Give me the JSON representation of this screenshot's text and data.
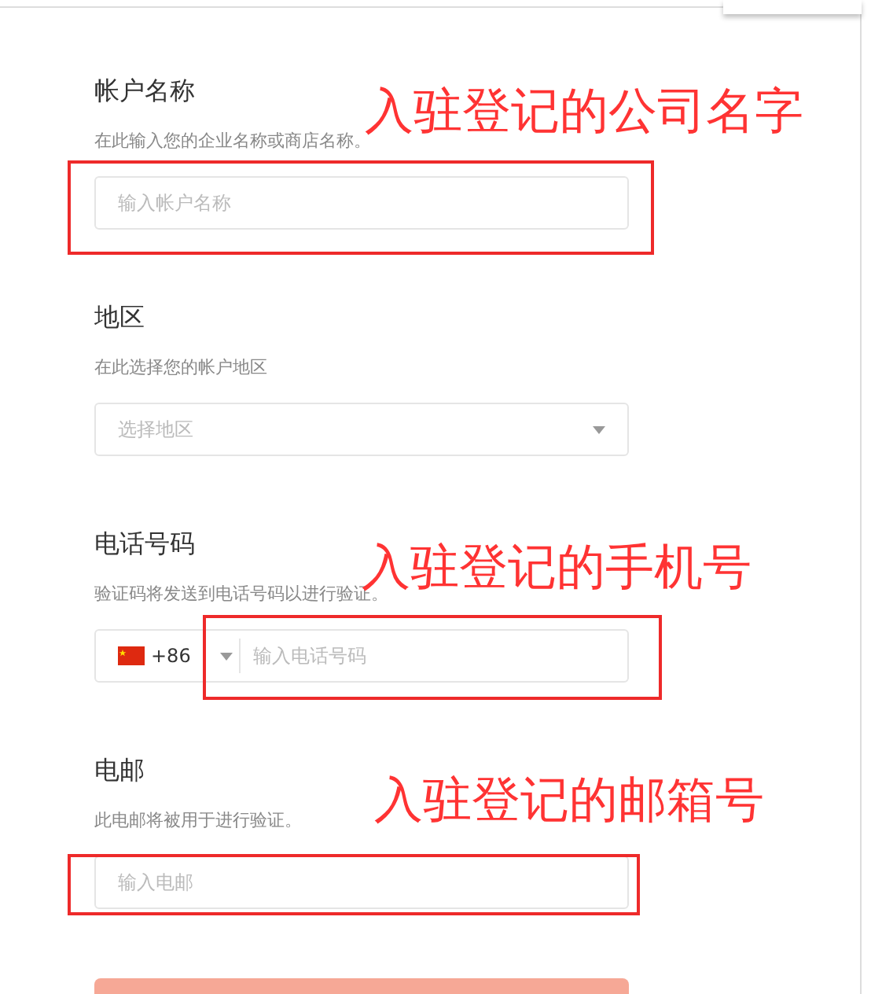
{
  "fields": [
    {
      "kind": "text",
      "label": "帐户名称",
      "hint": "在此输入您的企业名称或商店名称。",
      "placeholder": "输入帐户名称"
    },
    {
      "kind": "select",
      "label": "地区",
      "hint": "在此选择您的帐户地区",
      "placeholder": "选择地区"
    },
    {
      "kind": "phone",
      "label": "电话号码",
      "hint": "验证码将发送到电话号码以进行验证。",
      "country_code": "+86",
      "placeholder": "输入电话号码"
    },
    {
      "kind": "text",
      "label": "电邮",
      "hint": "此电邮将被用于进行验证。",
      "placeholder": "输入电邮"
    }
  ],
  "annotations": [
    {
      "text": "入驻登记的公司名字"
    },
    {
      "text": "入驻登记的手机号"
    },
    {
      "text": "入驻登记的邮箱号"
    }
  ]
}
